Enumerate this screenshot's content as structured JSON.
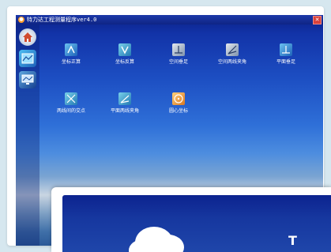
{
  "window": {
    "title": "特力达工程测量程序ver4.0",
    "close_glyph": "✕",
    "title_icon_glyph": "●"
  },
  "sidebar": {
    "items": [
      {
        "name": "home",
        "icon": "home-icon"
      },
      {
        "name": "map",
        "icon": "map-icon"
      },
      {
        "name": "monitor",
        "icon": "monitor-icon"
      }
    ]
  },
  "grid": {
    "items": [
      {
        "label": "坐标正算",
        "icon": "forward-calc-icon",
        "color": "#1d62b8"
      },
      {
        "label": "坐标反算",
        "icon": "inverse-calc-icon",
        "color": "#2379b4"
      },
      {
        "label": "空间垂足",
        "icon": "spatial-foot-icon",
        "color": "#7e93ad"
      },
      {
        "label": "空间两线夹角",
        "icon": "spatial-angle-icon",
        "color": "#7e93ad"
      },
      {
        "label": "平面垂足",
        "icon": "plane-foot-icon",
        "color": "#1d62b8"
      },
      {
        "label": "两线间的交点",
        "icon": "intersection-icon",
        "color": "#2379b4"
      },
      {
        "label": "平面两线夹角",
        "icon": "plane-angle-icon",
        "color": "#2379b4"
      },
      {
        "label": "圆心坐标",
        "icon": "circle-center-icon",
        "color": "#d9761f"
      }
    ]
  },
  "overlay": {
    "glyph": "T"
  }
}
